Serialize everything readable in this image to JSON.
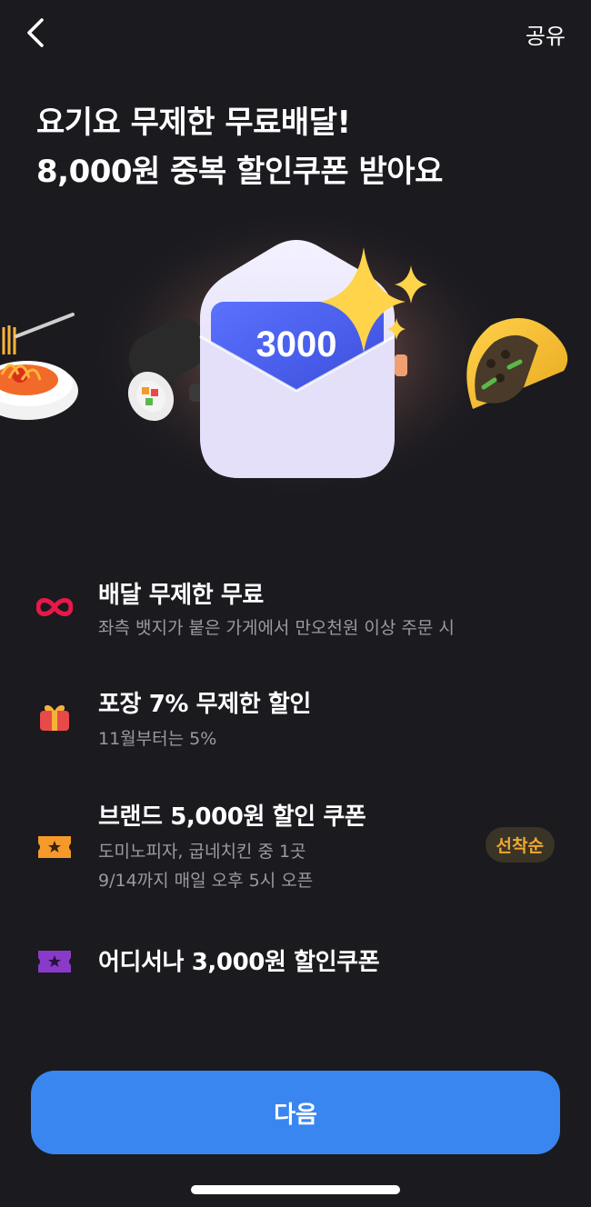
{
  "header": {
    "back_icon": "chevron-left-icon",
    "share_label": "공유"
  },
  "headline": {
    "line1": "요기요 무제한 무료배달!",
    "line2": "8,000원 중복 할인쿠폰 받아요"
  },
  "hero": {
    "coupon_amount": "3000",
    "illustrations": [
      "spaghetti-icon",
      "kimbap-icon",
      "envelope-icon",
      "sparkle-icon",
      "taco-icon"
    ]
  },
  "benefits": [
    {
      "icon": "infinity-icon",
      "title": "배달 무제한 무료",
      "desc": "좌측 뱃지가 붙은 가게에서 만오천원 이상 주문 시"
    },
    {
      "icon": "gift-icon",
      "title": "포장 7% 무제한 할인",
      "desc": "11월부터는 5%"
    },
    {
      "icon": "ticket-icon",
      "title": "브랜드 5,000원 할인 쿠폰",
      "desc": "도미노피자, 굽네치킨 중 1곳",
      "desc2": "9/14까지 매일 오후 5시 오픈",
      "badge": "선착순"
    },
    {
      "icon": "ticket-icon",
      "title": "어디서나 3,000원 할인쿠폰"
    }
  ],
  "footer": {
    "next_label": "다음"
  },
  "colors": {
    "background": "#1a1a1f",
    "primary": "#3a86f0",
    "badge_text": "#f0a830",
    "infinity": "#e8184a",
    "gift": "#e84a4a",
    "ticket_orange": "#f59a2a",
    "ticket_purple": "#8a3ac8"
  }
}
